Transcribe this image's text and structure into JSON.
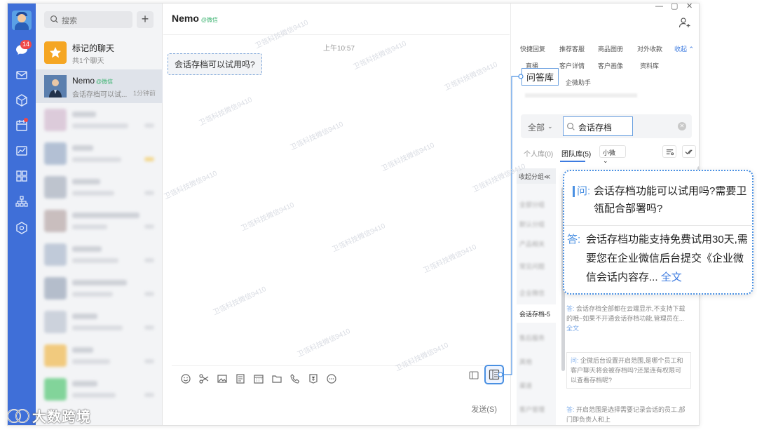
{
  "app": {
    "badge_count": "14",
    "colors": {
      "rail": "#3f6fd8",
      "accent": "#3d7be0",
      "badge": "#f04848",
      "wechat": "#3cb371",
      "highlight": "#4a90e2"
    }
  },
  "sidebar_icons": [
    "chat-icon",
    "mail-icon",
    "cube-icon",
    "calendar-icon",
    "chart-icon",
    "apps-icon",
    "org-icon",
    "hexagon-icon"
  ],
  "list": {
    "search_placeholder": "搜索",
    "plus": "+",
    "starred": {
      "name": "标记的聊天",
      "sub": "共1个聊天"
    },
    "active": {
      "name": "Nemo",
      "wechat_tag": "@微信",
      "preview": "会话存档可以试...",
      "time": "1分钟前"
    }
  },
  "chat": {
    "title": "Nemo",
    "wechat_tag": "@微信",
    "timestamp": "上午10:57",
    "message": "会话存档可以试用吗?",
    "send_label": "发送(S)"
  },
  "panel": {
    "tabs_row1": [
      "快捷回复",
      "推荐客服",
      "商品图册",
      "对外收款"
    ],
    "collapse": "收起 ⌃",
    "tabs_row2": [
      "直播",
      "客户详情",
      "客户画像",
      "资料库"
    ],
    "qa_tab": "问答库",
    "tab_row3_extra": "企微助手",
    "filter_all": "全部",
    "search_value": "会话存档",
    "lib_personal": "个人库(0)",
    "lib_team": "团队库(5)",
    "lib_select": "小微",
    "collapse_groups": "收起分组≪",
    "selected_group": "会话存档-5",
    "answers": [
      {
        "tag": "答:",
        "text": "会话存档全部都在云端显示,不支持下载的哦~如果不开通会话存档功能,管理员在...",
        "more": "全文"
      },
      {
        "tag": "问:",
        "text": "企微后台设置开启范围,是哪个员工和客户聊天将会被存档吗?还是连有权限可以查看存档呢?"
      },
      {
        "tag": "答:",
        "text": "开启范围是选择需要记录会话的员工,部门即负责人和上"
      }
    ]
  },
  "popup": {
    "q_tag": "问:",
    "question": "会话存档功能可以试用吗?需要卫瓴配合部署吗?",
    "a_tag": "答:",
    "answer": "会话存档功能支持免费试用30天,需要您在企业微信后台提交《企业微信会话内容存...",
    "full": "全文"
  },
  "watermark": "卫瓴科技微信9410",
  "logo_text": "大数跨境"
}
